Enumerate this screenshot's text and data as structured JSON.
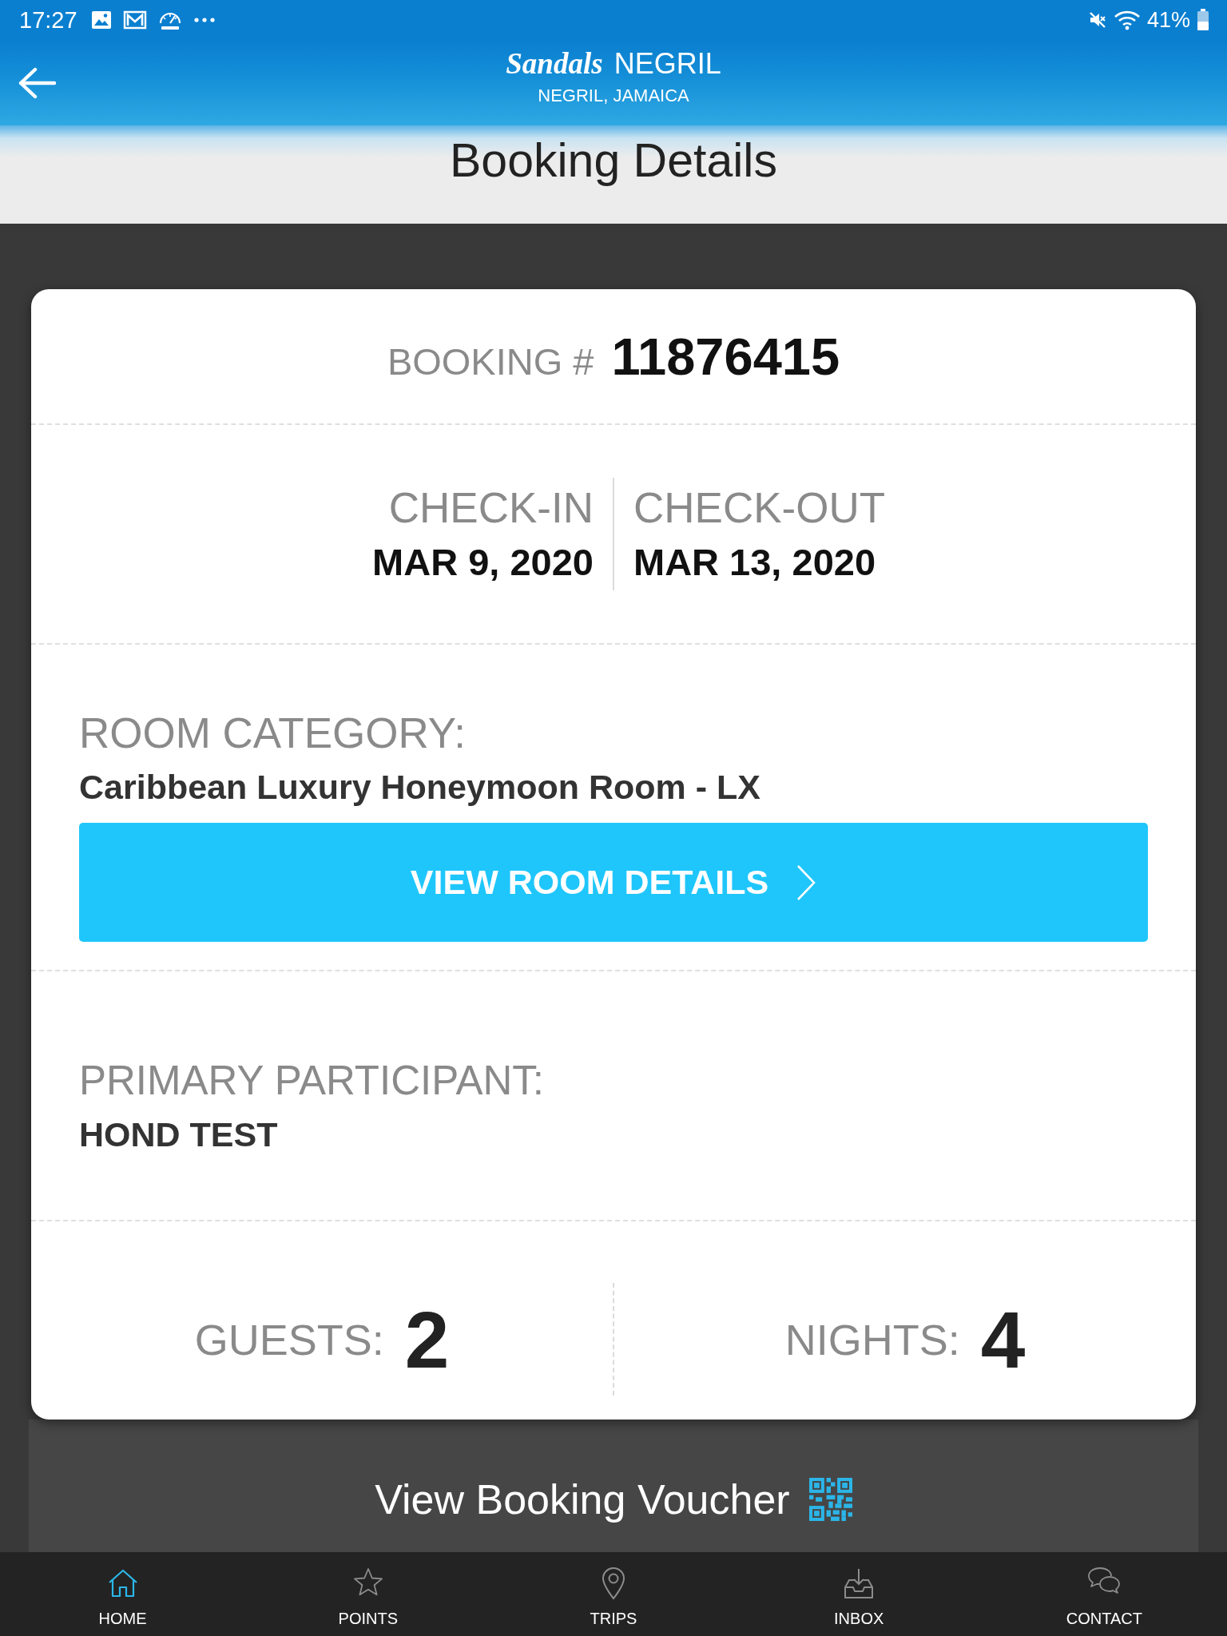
{
  "status_bar": {
    "time": "17:27",
    "battery": "41%"
  },
  "header": {
    "brand": "Sandals",
    "resort": "NEGRIL",
    "location": "NEGRIL, JAMAICA"
  },
  "page_title": "Booking Details",
  "booking": {
    "label": "BOOKING #",
    "number": "11876415"
  },
  "dates": [
    {
      "label": "CHECK-IN",
      "value": "MAR 9, 2020"
    },
    {
      "label": "CHECK-OUT",
      "value": "MAR 13, 2020"
    }
  ],
  "room": {
    "label": "ROOM CATEGORY:",
    "value": "Caribbean Luxury Honeymoon Room - LX",
    "button": "VIEW ROOM DETAILS"
  },
  "participant": {
    "label": "PRIMARY PARTICIPANT:",
    "value": "HOND TEST"
  },
  "stats": [
    {
      "label": "GUESTS:",
      "value": "2"
    },
    {
      "label": "NIGHTS:",
      "value": "4"
    }
  ],
  "voucher_button": "View Booking Voucher",
  "bottom_nav": [
    {
      "label": "HOME",
      "kind": "home",
      "selected": true
    },
    {
      "label": "POINTS",
      "kind": "points",
      "selected": false
    },
    {
      "label": "TRIPS",
      "kind": "trips",
      "selected": false
    },
    {
      "label": "INBOX",
      "kind": "inbox",
      "selected": false
    },
    {
      "label": "CONTACT",
      "kind": "contact",
      "selected": false
    }
  ]
}
